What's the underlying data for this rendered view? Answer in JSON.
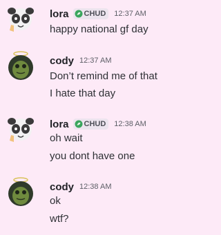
{
  "messages": [
    {
      "username": "lora",
      "tag": "CHUD",
      "timestamp": "12:37 AM",
      "lines": [
        "happy national gf day"
      ]
    },
    {
      "username": "cody",
      "tag": "",
      "timestamp": "12:37 AM",
      "lines": [
        "Don’t remind me of that",
        "I hate that day"
      ]
    },
    {
      "username": "lora",
      "tag": "CHUD",
      "timestamp": "12:38 AM",
      "lines": [
        "oh wait",
        "you dont have one"
      ]
    },
    {
      "username": "cody",
      "tag": "",
      "timestamp": "12:38 AM",
      "lines": [
        "ok",
        "wtf?"
      ]
    }
  ],
  "colors": {
    "background": "#fdeaf7",
    "username": "#1f2025",
    "text": "#2e3035",
    "timestamp": "#5c5e66",
    "tag_bg": "#ece4ee",
    "tag_icon": "#3aa55d"
  },
  "icons": {
    "lora_avatar": "panda-avatar-icon",
    "cody_avatar": "frog-angel-avatar-icon",
    "tag_icon": "leaf-badge-icon"
  }
}
